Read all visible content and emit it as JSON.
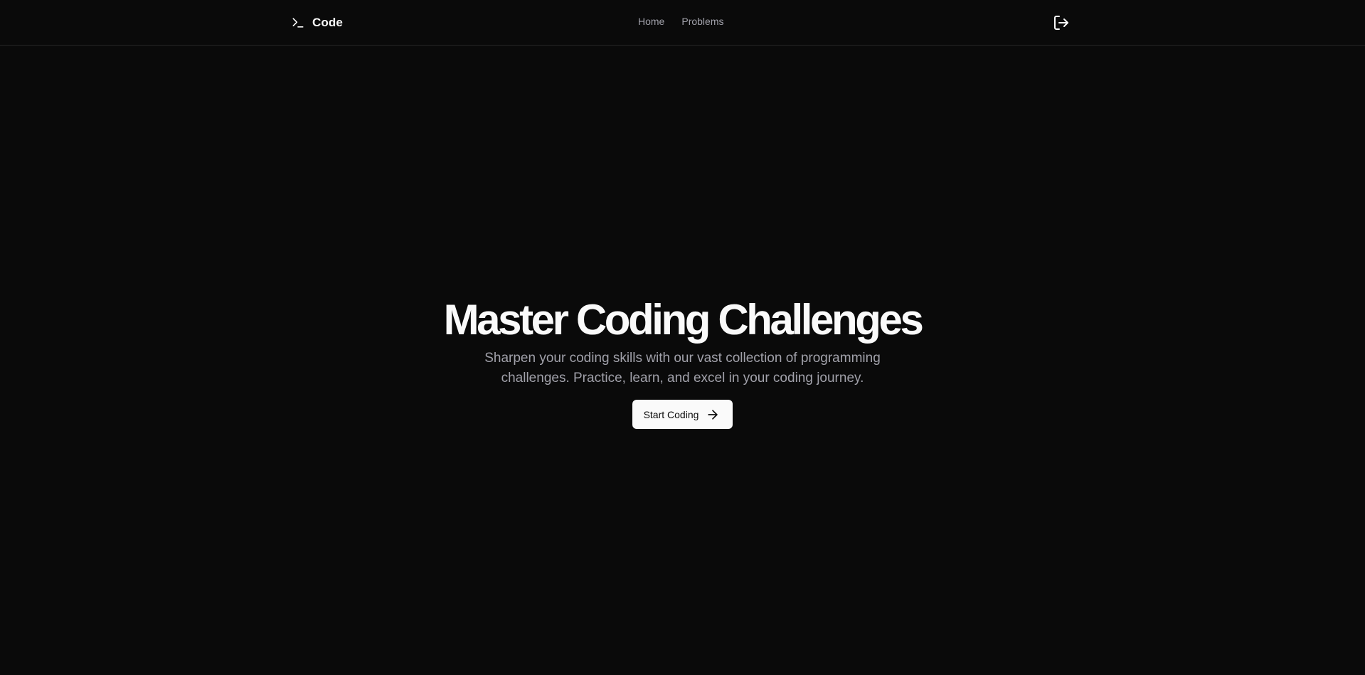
{
  "header": {
    "brand": {
      "icon": "terminal-icon",
      "label": "Code"
    },
    "nav": [
      {
        "label": "Home"
      },
      {
        "label": "Problems"
      }
    ],
    "logout_icon": "log-out-icon"
  },
  "hero": {
    "title": "Master Coding Challenges",
    "subtitle": "Sharpen your coding skills with our vast collection of programming challenges. Practice, learn, and excel in your coding journey.",
    "cta_label": "Start Coding",
    "cta_icon": "arrow-right-icon"
  },
  "colors": {
    "background": "#0a0a0a",
    "foreground": "#fafafa",
    "muted": "#a1a1aa",
    "border": "#262626"
  }
}
